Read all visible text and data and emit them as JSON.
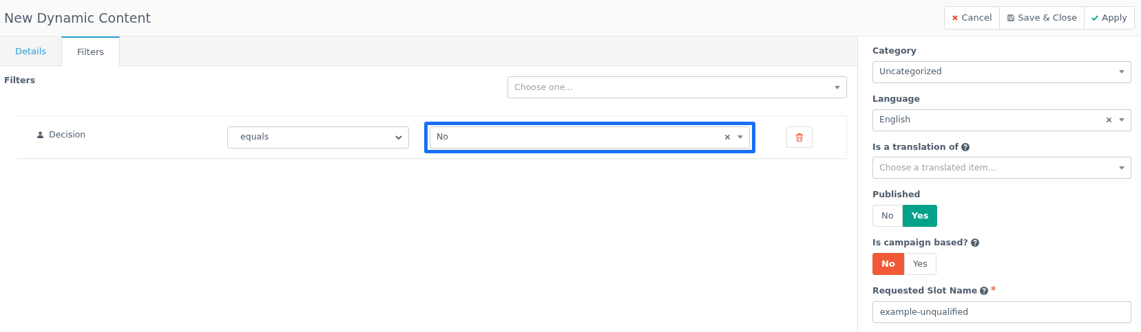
{
  "header": {
    "title": "New Dynamic Content",
    "buttons": [
      {
        "label": "Cancel"
      },
      {
        "label": "Save & Close"
      },
      {
        "label": "Apply"
      }
    ]
  },
  "tabs": [
    {
      "label": "Details",
      "selected": false
    },
    {
      "label": "Filters",
      "selected": true
    }
  ],
  "filters": {
    "heading": "Filters",
    "add_placeholder": "Choose one...",
    "rows": [
      {
        "field": "Decision",
        "operator": "equals",
        "value": "No",
        "highlighted": true
      }
    ]
  },
  "sidebar": {
    "fields": [
      {
        "kind": "select",
        "label": "Category",
        "value": "Uncategorized"
      },
      {
        "kind": "select",
        "label": "Language",
        "value": "English",
        "clearable": true
      },
      {
        "kind": "select",
        "label": "Is a translation of",
        "help": true,
        "placeholder": "Choose a translated item..."
      },
      {
        "kind": "toggle",
        "label": "Published",
        "options": [
          {
            "label": "No",
            "selected": false
          },
          {
            "label": "Yes",
            "selected": true,
            "color": "#04a28b"
          }
        ]
      },
      {
        "kind": "toggle",
        "label": "Is campaign based?",
        "help": true,
        "options": [
          {
            "label": "No",
            "selected": true,
            "color": "#f05a38"
          },
          {
            "label": "Yes",
            "selected": false
          }
        ]
      },
      {
        "kind": "text",
        "label": "Requested Slot Name",
        "help": true,
        "required": true,
        "value": "example-unqualified"
      }
    ]
  }
}
